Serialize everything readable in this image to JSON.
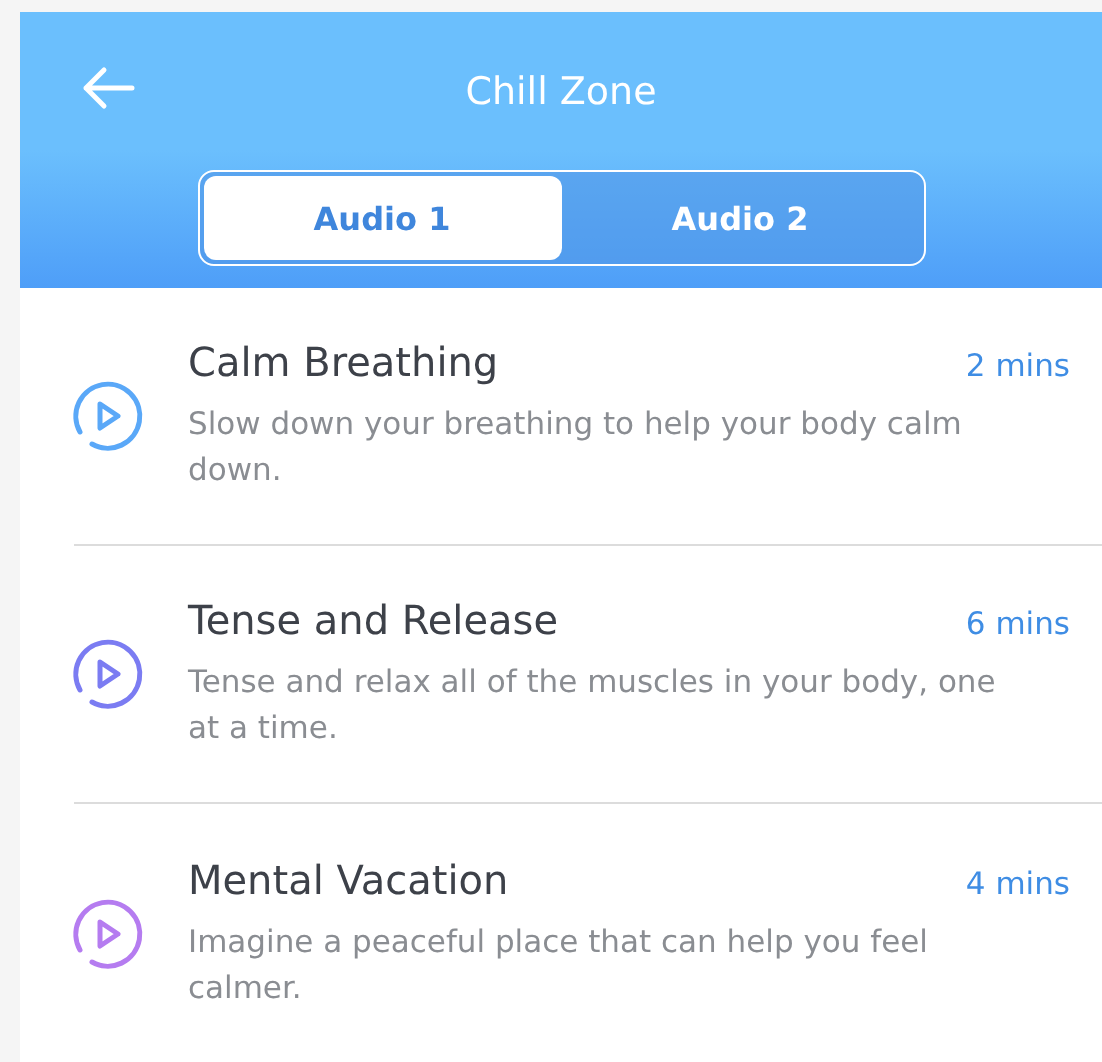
{
  "header": {
    "title": "Chill Zone"
  },
  "tabs": [
    {
      "label": "Audio 1",
      "selected": true
    },
    {
      "label": "Audio 2",
      "selected": false
    }
  ],
  "tracks": [
    {
      "title": "Calm Breathing",
      "duration": "2 mins",
      "description": "Slow down your breathing to help your body calm down.",
      "color": "#5aa8f8"
    },
    {
      "title": "Tense and Release",
      "duration": "6 mins",
      "description": "Tense and relax all of the muscles in your body, one at a time.",
      "color": "#7b7cf2"
    },
    {
      "title": "Mental Vacation",
      "duration": "4 mins",
      "description": "Imagine a peaceful place that can help you feel calmer.",
      "color": "#b57cf0"
    }
  ]
}
